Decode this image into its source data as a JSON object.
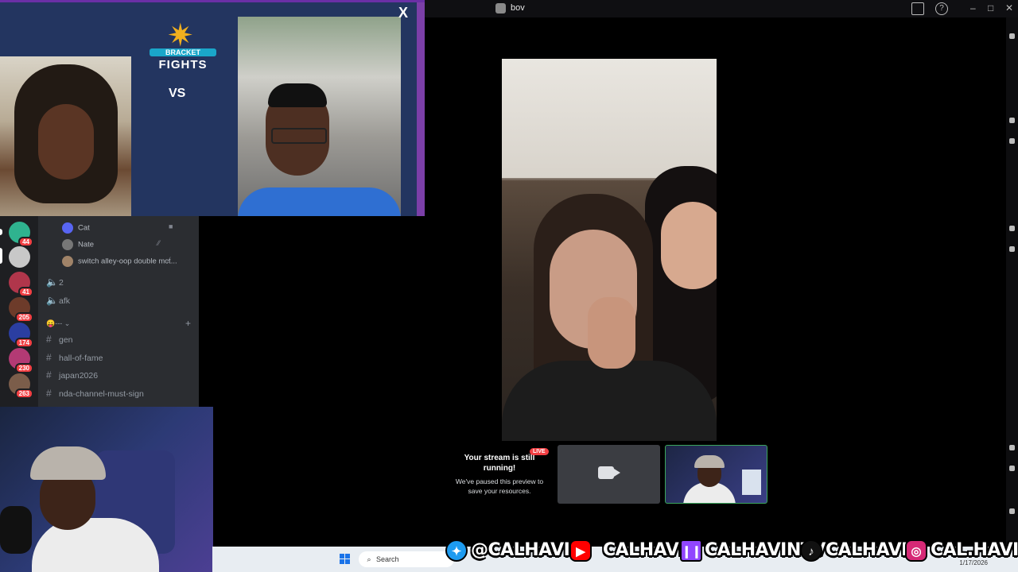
{
  "window": {
    "title": "bov"
  },
  "overlay": {
    "logo_line1": "BRACKET",
    "logo_line2": "FIGHTS",
    "vs": "VS",
    "close": "X"
  },
  "sidebar": {
    "servers": [
      {
        "badge": "44",
        "color": "#2fb38f"
      },
      {
        "badge": "",
        "color": "#c8c8c8"
      },
      {
        "badge": "41",
        "color": "#b0364b"
      },
      {
        "badge": "205",
        "color": "#6d3b2a"
      },
      {
        "badge": "174",
        "color": "#2b3ea1"
      },
      {
        "badge": "230",
        "color": "#b33a74"
      },
      {
        "badge": "263",
        "color": "#7b5d4a"
      }
    ],
    "voice_users": [
      {
        "name": "Cat"
      },
      {
        "name": "Nate"
      },
      {
        "name": "switch alley-oop double mct..."
      }
    ],
    "voice_channels": [
      "2",
      "afk"
    ],
    "category": "😛---",
    "text_channels": [
      "gen",
      "hall-of-fame",
      "japan2026",
      "nda-channel-must-sign"
    ]
  },
  "stream": {
    "paused_title": "Your stream is still running!",
    "paused_sub": "We've paused this preview to save your resources.",
    "live_badge": "LIVE"
  },
  "taskbar": {
    "search_placeholder": "Search",
    "date": "1/17/2026"
  },
  "social": [
    {
      "icon": "twitter-icon",
      "handle": "@CALHAVIN",
      "color": "#1d9bf0"
    },
    {
      "icon": "youtube-icon",
      "handle": "CALHAVIN",
      "color": "#ff0000"
    },
    {
      "icon": "twitch-icon",
      "handle": "CALHAVINTV",
      "color": "#9146ff"
    },
    {
      "icon": "tiktok-icon",
      "handle": "CALHAVIN",
      "color": "#111111"
    },
    {
      "icon": "instagram-icon",
      "handle": "CAL.HAVIN",
      "color": "#d62976"
    }
  ]
}
